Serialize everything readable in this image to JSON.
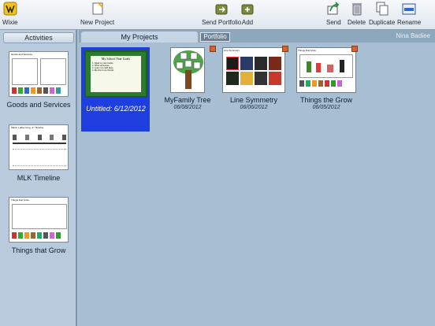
{
  "toolbar": {
    "app_label": "Wixie",
    "new_project": "New Project",
    "send_portfolio": "Send Portfolio",
    "add": "Add",
    "send": "Send",
    "delete": "Delete",
    "duplicate": "Duplicate",
    "rename": "Rename"
  },
  "sidebar": {
    "tab_label": "Activities",
    "items": [
      {
        "label": "Goods and Services",
        "thumb_title": "Goods and Services"
      },
      {
        "label": "MLK Timeline",
        "thumb_title": "Martin Luther King, Jr. Timeline"
      },
      {
        "label": "Things that Grow",
        "thumb_title": "Things that Grow"
      }
    ]
  },
  "main": {
    "tabs": [
      {
        "label": "My Projects"
      },
      {
        "label": "Portfolio"
      }
    ],
    "user_name": "Nina Badiee",
    "projects": [
      {
        "title": "Untitled: 6/12/2012",
        "date": "",
        "thumb_heading": "My School Year Goals",
        "thumb_lines": [
          "1. Read my own books.",
          "2. Write sentences.",
          "3. Learn my math facts.",
          "4. Be nice to my friends."
        ]
      },
      {
        "title": "MyFamily Tree",
        "date": "06/08/2012"
      },
      {
        "title": "Line Symmetry",
        "date": "06/06/2012",
        "thumb_heading": "Line Symmetry"
      },
      {
        "title": "Things the Grow",
        "date": "06/05/2012",
        "thumb_heading": "Things that Grow"
      }
    ]
  },
  "colors": {
    "selection": "#1e3ee0",
    "toolbar_bg": "#e8edf2",
    "main_bg": "#a8bed2",
    "badge": "#d9622b"
  }
}
